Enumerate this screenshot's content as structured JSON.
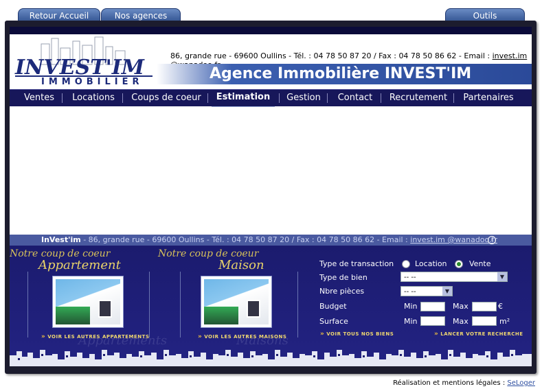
{
  "tabs": {
    "retour": "Retour Accueil",
    "agences": "Nos agences",
    "outils": "Outils"
  },
  "logo": {
    "main": "INVEST'IM",
    "sub": "IMMOBILIER"
  },
  "header": {
    "address": "86, grande rue - 69600 Oullins - Tél. : 04 78 50 87 20 / Fax : 04 78 50 86 62 - Email : ",
    "email": "invest.im @wanadoo.fr",
    "banner": "Agence Immobilière INVEST'IM"
  },
  "nav": [
    "Ventes",
    "Locations",
    "Coups de coeur",
    "Estimation",
    "Gestion",
    "Contact",
    "Recrutement",
    "Partenaires"
  ],
  "footer": {
    "brand": "InVest'im",
    "address": " - 86, grande rue - 69600 Oullins - Tél. : 04 78 50 87 20 / Fax : 04 78 50 86 62 - Email : ",
    "email": "invest.im @wanadoo.fr",
    "info_icon": "info-icon"
  },
  "coup1": {
    "title": "Notre coup de coeur",
    "subtitle": "Appartement",
    "watermark": "Appartements",
    "link": "VOIR LES AUTRES APPARTEMENTS"
  },
  "coup2": {
    "title": "Notre coup de coeur",
    "subtitle": "Maison",
    "watermark": "Maisons",
    "link": "VOIR LES AUTRES MAISONS"
  },
  "search": {
    "transaction_label": "Type de transaction",
    "location": "Location",
    "vente": "Vente",
    "bien_label": "Type de bien",
    "bien_value": "-- --",
    "pieces_label": "Nbre pièces",
    "pieces_value": "-- --",
    "budget_label": "Budget",
    "surface_label": "Surface",
    "min": "Min",
    "max": "Max",
    "euro": "€",
    "m2": "m²",
    "all_link": "VOIR TOUS NOS BIENS",
    "launch_link": "LANCER VOTRE RECHERCHE"
  },
  "credit": {
    "text": "Réalisation et mentions légales : ",
    "link": "SeLoger"
  }
}
